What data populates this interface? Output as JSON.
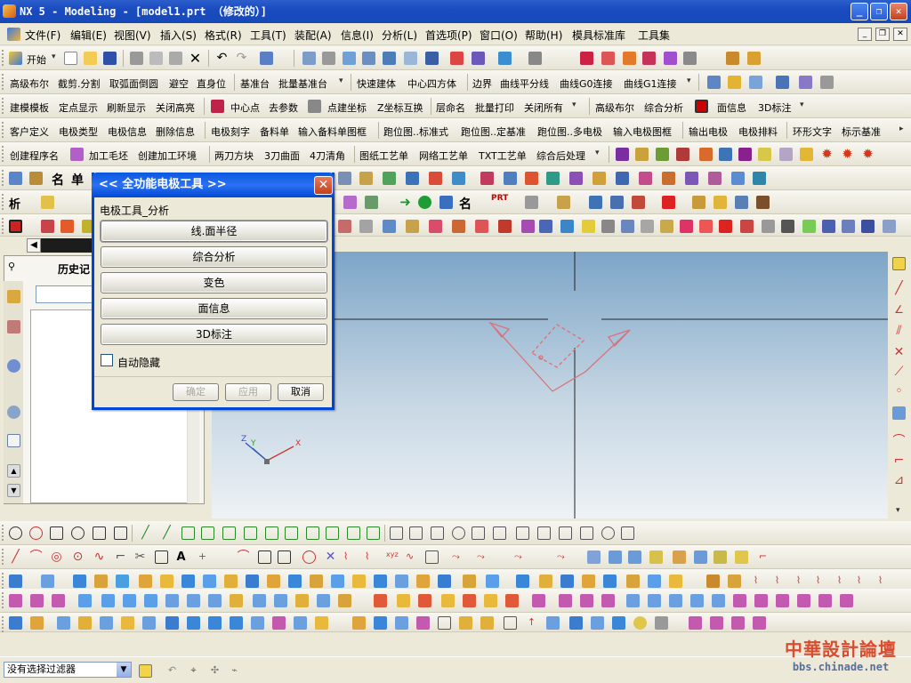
{
  "window": {
    "title": "NX 5 - Modeling - [model1.prt （修改的）]",
    "minimize": "_",
    "restore": "❐",
    "close": "✕"
  },
  "menubar": {
    "items": [
      "文件(F)",
      "编辑(E)",
      "视图(V)",
      "插入(S)",
      "格式(R)",
      "工具(T)",
      "装配(A)",
      "信息(I)",
      "分析(L)",
      "首选项(P)",
      "窗口(O)",
      "帮助(H)",
      "模具标准库",
      "工具集"
    ]
  },
  "toolbar1": {
    "start": "开始"
  },
  "toolbar2": {
    "labels": [
      "高级布尔",
      "截剪.分割",
      "取弧面倒圆",
      "避空",
      "直身位",
      "基准台",
      "批量基准台",
      "快速建体",
      "中心四方体",
      "边界",
      "曲线平分线",
      "曲线G0连接",
      "曲线G1连接"
    ]
  },
  "toolbar3": {
    "labels": [
      "建模模板",
      "定点显示",
      "刷新显示",
      "关闭高亮",
      "中心点",
      "去参数",
      "点建坐标",
      "Z坐标互换",
      "层命名",
      "批量打印",
      "关闭所有",
      "高级布尔",
      "综合分析",
      "面信息",
      "3D标注"
    ]
  },
  "toolbar4": {
    "labels": [
      "客户定义",
      "电极类型",
      "电极信息",
      "删除信息",
      "电极刻字",
      "备料单",
      "输入备料单图框",
      "跑位图..标准式",
      "跑位图..定基准",
      "跑位图..多电极",
      "输入电极图框",
      "输出电极",
      "电极排料",
      "环形文字",
      "标示基准"
    ]
  },
  "toolbar5": {
    "labels": [
      "创建程序名",
      "加工毛坯",
      "创建加工环境",
      "两刀方块",
      "3刀曲面",
      "4刀清角",
      "图纸工艺单",
      "网络工艺单",
      "TXT工艺单",
      "综合后处理"
    ]
  },
  "toolbar6": {
    "labels": [
      "名",
      "单"
    ]
  },
  "toolbar7": {
    "labels": [
      "析",
      "名",
      "PRT"
    ]
  },
  "navpane": {
    "title": "历史记"
  },
  "dialog": {
    "title": "<< 全功能电极工具 >>",
    "close": "✕",
    "group_label": "电极工具_分析",
    "buttons": [
      "线.面半径",
      "综合分析",
      "变色",
      "面信息",
      "3D标注"
    ],
    "checkbox_label": "自动隐藏",
    "ok": "确定",
    "apply": "应用",
    "cancel": "取消"
  },
  "triad": {
    "x": "X",
    "y": "Y",
    "z": "Z"
  },
  "statusbar": {
    "filter": "没有选择过滤器"
  },
  "watermark": {
    "line1": "中華設計論壇",
    "line2": "bbs.chinade.net"
  },
  "colors": {
    "title_blue": "#1a4bc0",
    "dialog_blue": "#0046d5",
    "sketch": "#d9727a",
    "accent_orange": "#e84a10"
  }
}
